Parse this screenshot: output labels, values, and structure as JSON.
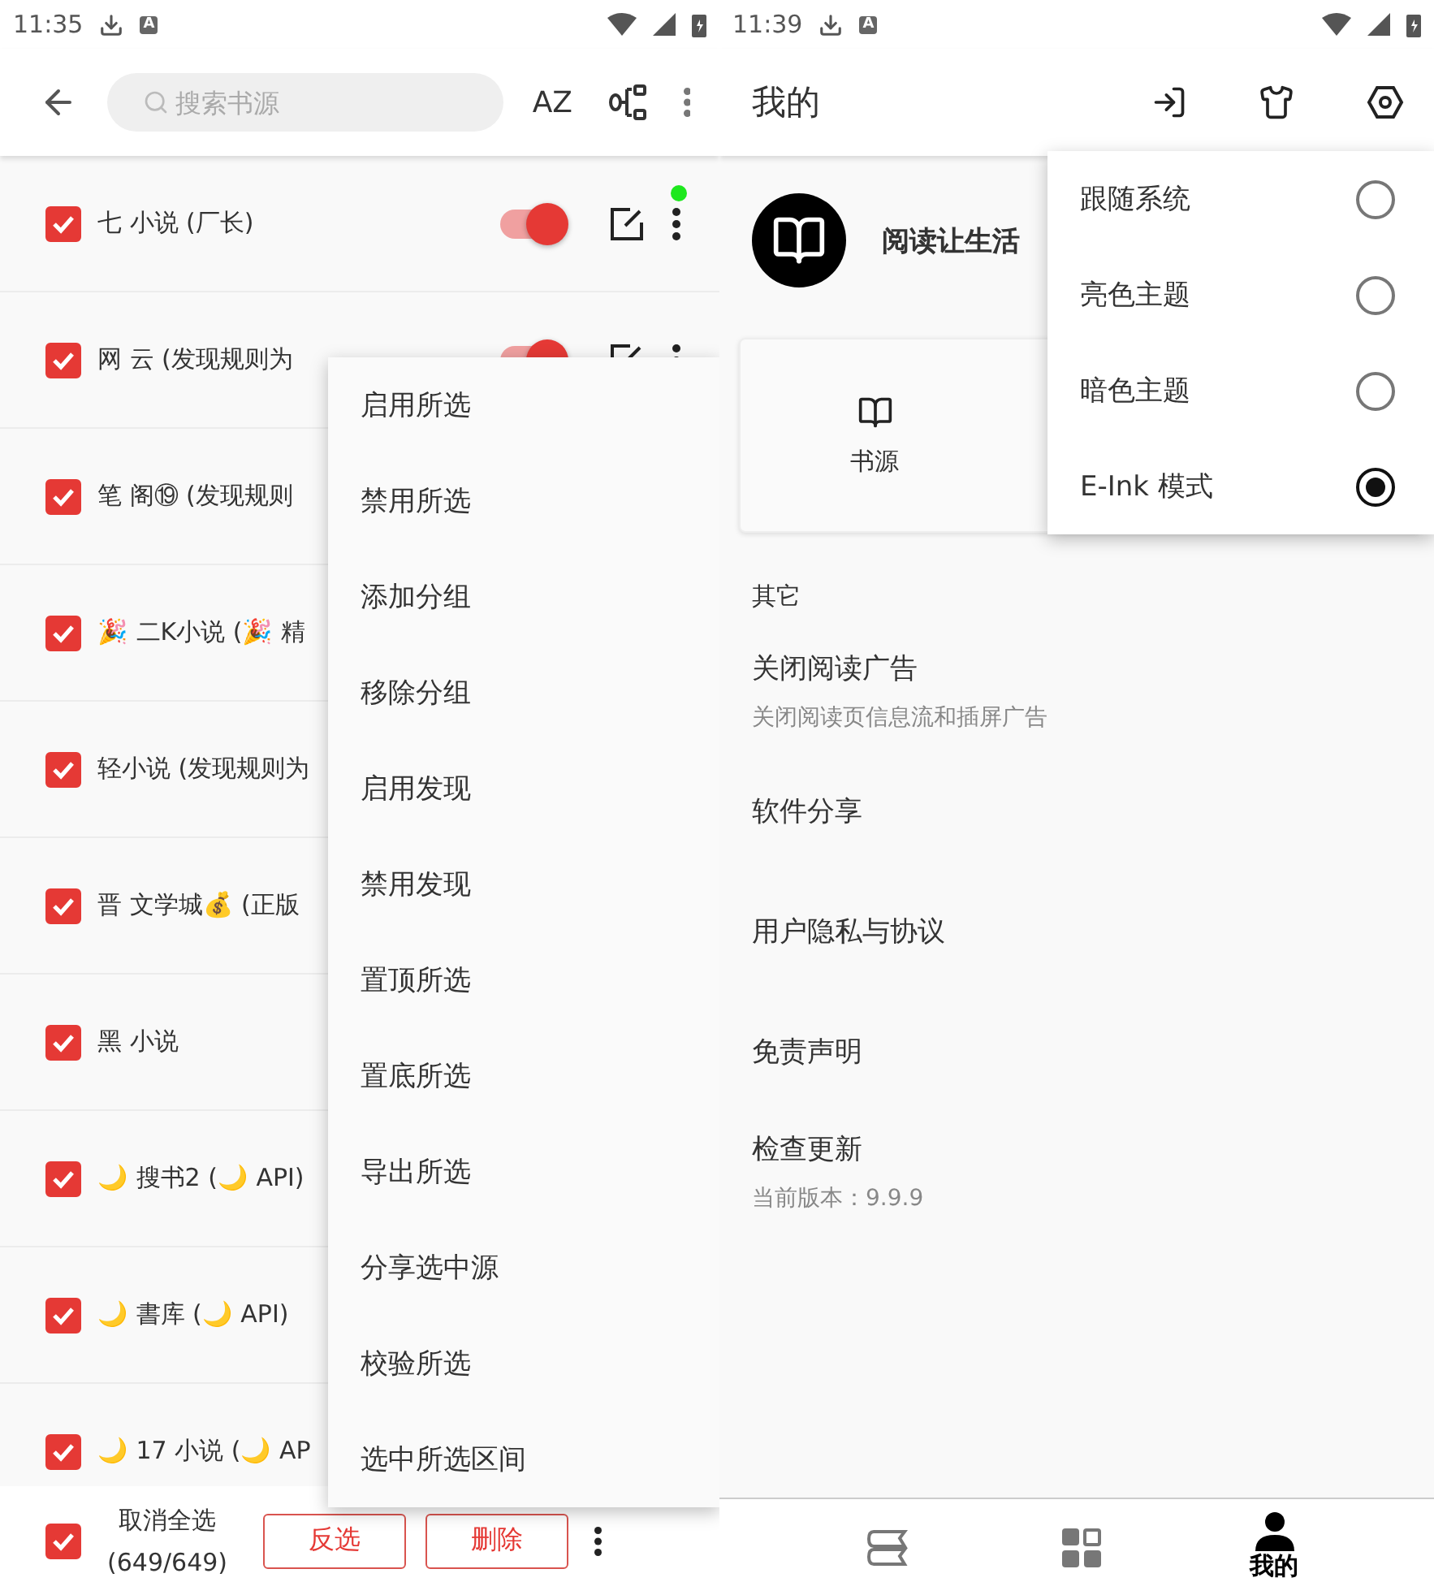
{
  "left": {
    "status_bar": {
      "time": "11:35",
      "notice": "A"
    },
    "toolbar": {
      "search_placeholder": "搜索书源",
      "sort_label": "AZ"
    },
    "sources": [
      {
        "name": "七 小说 (厂长)",
        "checked": true,
        "enabled": true,
        "color": "#1ee81e"
      },
      {
        "name": "网 云 (发现规则为",
        "checked": true,
        "enabled": true
      },
      {
        "name": "笔 阁⑲ (发现规则",
        "checked": true
      },
      {
        "name": "🎉 二K小说 (🎉 精",
        "checked": true
      },
      {
        "name": "轻小说 (发现规则为",
        "checked": true
      },
      {
        "name": "晋 文学城💰 (正版",
        "checked": true
      },
      {
        "name": "黑 小说",
        "checked": true
      },
      {
        "name": "🌙 搜书2 (🌙 API)",
        "checked": true
      },
      {
        "name": "🌙 書库 (🌙 API)",
        "checked": true
      },
      {
        "name": "🌙 17 小说 (🌙 AP",
        "checked": true
      }
    ],
    "selection_bar": {
      "checked": true,
      "label": "取消全选",
      "count": "(649/649)",
      "buttons": [
        "反选",
        "删除"
      ]
    },
    "batch_menu": [
      "启用所选",
      "禁用所选",
      "添加分组",
      "移除分组",
      "启用发现",
      "禁用发现",
      "置顶所选",
      "置底所选",
      "导出所选",
      "分享选中源",
      "校验所选",
      "选中所选区间"
    ]
  },
  "right": {
    "status_bar": {
      "time": "11:39",
      "notice": "A"
    },
    "title": "我的",
    "profile_name": "阅读让生活",
    "shortcuts": [
      {
        "label": "书源"
      }
    ],
    "section": "其它",
    "settings": [
      {
        "title": "关闭阅读广告",
        "subtitle": "关闭阅读页信息流和插屏广告"
      },
      {
        "title": "软件分享"
      },
      {
        "title": "用户隐私与协议"
      },
      {
        "title": "免责声明"
      },
      {
        "title": "检查更新",
        "subtitle": "当前版本：9.9.9"
      }
    ],
    "theme_menu": [
      {
        "label": "跟随系统",
        "selected": false
      },
      {
        "label": "亮色主题",
        "selected": false
      },
      {
        "label": "暗色主题",
        "selected": false
      },
      {
        "label": "E-Ink 模式",
        "selected": true
      }
    ],
    "nav": [
      {
        "kind": "bookshelf",
        "selected": false
      },
      {
        "kind": "explore",
        "selected": false
      },
      {
        "kind": "profile",
        "label": "我的",
        "selected": true
      }
    ]
  }
}
